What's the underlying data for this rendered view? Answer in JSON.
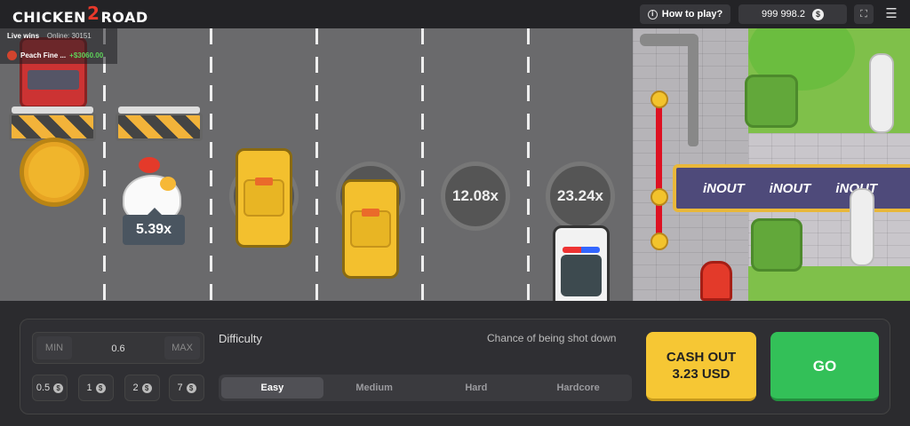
{
  "header": {
    "logo_text_a": "CHICKEN",
    "logo_text_b": "2",
    "logo_text_c": "ROAD",
    "how_to_play": "How to play?",
    "balance": "999 998.2",
    "currency_icon": "$",
    "fullscreen_icon": "⛶",
    "menu_icon": "☰"
  },
  "live": {
    "live_wins_label": "Live wins",
    "online_label": "Online:",
    "online_count": "30151",
    "winner_name": "Peach Fine ...",
    "winner_amount": "+$3060.00"
  },
  "road": {
    "current_multiplier": "5.39x",
    "manholes": [
      "12.08x",
      "23.24x"
    ],
    "banner_texts": [
      "iNOUT",
      "iNOUT",
      "iNOUT"
    ]
  },
  "controls": {
    "bet_min_label": "MIN",
    "bet_value": "0.6",
    "bet_max_label": "MAX",
    "quick_bets": [
      "0.5",
      "1",
      "2",
      "7"
    ],
    "quick_bet_icon": "$",
    "difficulty_label": "Difficulty",
    "chance_label": "Chance of being shot down",
    "difficulties": [
      "Easy",
      "Medium",
      "Hard",
      "Hardcore"
    ],
    "selected_difficulty": "Easy",
    "cashout_line1": "CASH OUT",
    "cashout_line2": "3.23 USD",
    "go_label": "GO"
  },
  "colors": {
    "accent_yellow": "#f6c734",
    "go_green": "#33c058",
    "road": "#6a6a6c",
    "panel": "#2f2f33"
  }
}
